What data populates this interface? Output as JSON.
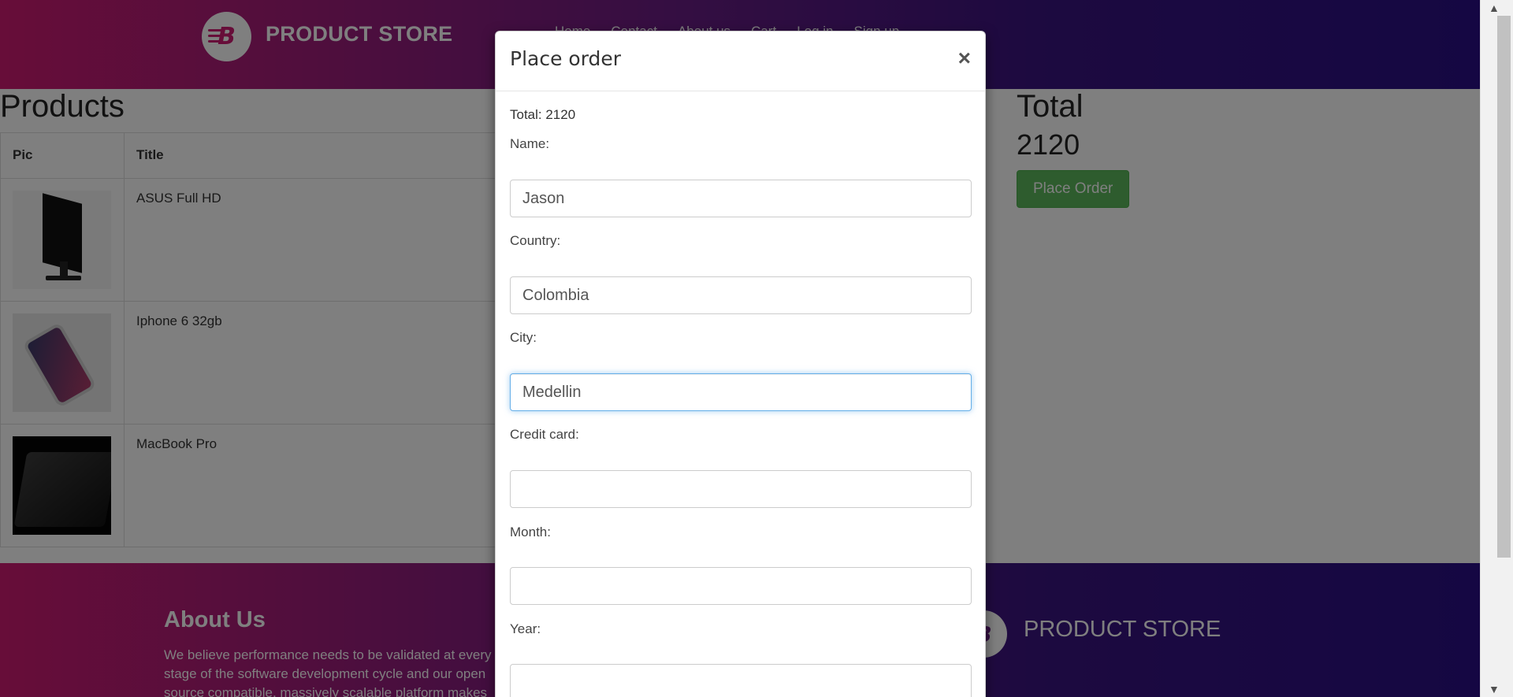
{
  "navbar": {
    "brand": "PRODUCT STORE",
    "logo_letter": "B",
    "links": [
      "Home",
      "Contact",
      "About us",
      "Cart",
      "Log in",
      "Sign up"
    ]
  },
  "products": {
    "heading": "Products",
    "columns": [
      "Pic",
      "Title"
    ],
    "rows": [
      {
        "title": "ASUS Full HD",
        "image": "monitor-image"
      },
      {
        "title": "Iphone 6 32gb",
        "image": "phone-image"
      },
      {
        "title": "MacBook Pro",
        "image": "laptop-image"
      }
    ]
  },
  "summary": {
    "heading": "Total",
    "value": "2120",
    "place_order_label": "Place Order",
    "button_color": "#5cb85c"
  },
  "footer": {
    "about_title": "About Us",
    "about_text": "We believe performance needs to be validated at every stage of the software development cycle and our open source compatible, massively scalable platform makes that a reality.",
    "brand": "PRODUCT STORE"
  },
  "modal": {
    "title": "Place order",
    "close": "×",
    "total_line": "Total: 2120",
    "fields": {
      "name": {
        "label": "Name:",
        "value": "Jason"
      },
      "country": {
        "label": "Country:",
        "value": "Colombia"
      },
      "city": {
        "label": "City:",
        "value": "Medellin"
      },
      "card": {
        "label": "Credit card:",
        "value": ""
      },
      "month": {
        "label": "Month:",
        "value": ""
      },
      "year": {
        "label": "Year:",
        "value": ""
      }
    }
  },
  "scrollbar": {
    "up": "▲",
    "down": "▼"
  },
  "colors": {
    "gradient_start": "#cf1b72",
    "gradient_end": "#2a0f86",
    "focus_border": "#66afe9"
  }
}
